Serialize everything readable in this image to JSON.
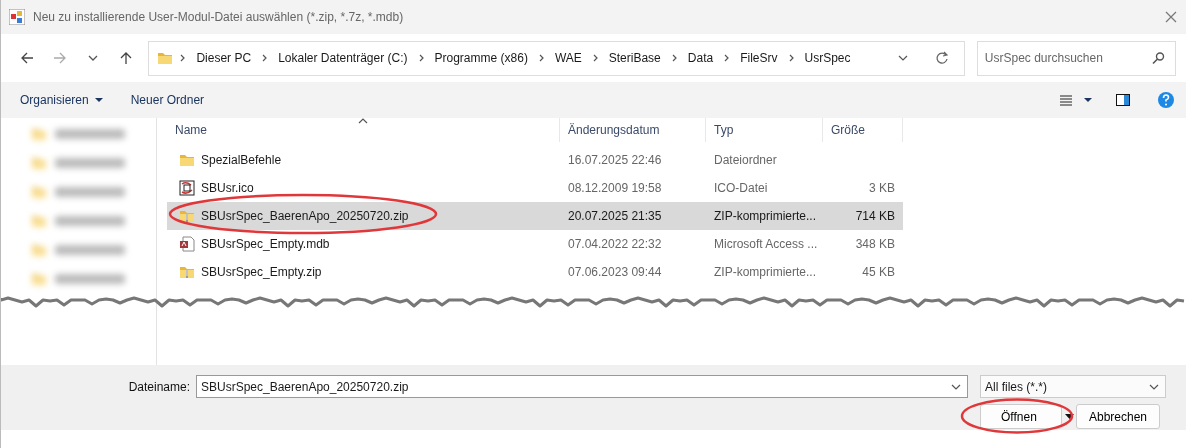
{
  "window": {
    "title": "Neu zu installierende User-Modul-Datei auswählen (*.zip, *.7z, *.mdb)"
  },
  "address_bar": {
    "breadcrumbs": [
      "Dieser PC",
      "Lokaler Datenträger (C:)",
      "Programme (x86)",
      "WAE",
      "SteriBase",
      "Data",
      "FileSrv",
      "UsrSpec"
    ]
  },
  "search": {
    "placeholder": "UsrSpec durchsuchen"
  },
  "toolbar": {
    "buttons": [
      {
        "label": "Organisieren",
        "kind": "menu"
      },
      {
        "label": "Neuer Ordner",
        "kind": "plain"
      }
    ]
  },
  "sidebar": {
    "items": [
      {
        "kind": "blurred"
      },
      {
        "kind": "blurred"
      },
      {
        "kind": "blurred"
      },
      {
        "kind": "blurred"
      },
      {
        "kind": "blurred"
      },
      {
        "kind": "blurred"
      }
    ]
  },
  "table": {
    "columns": [
      {
        "label": "Name",
        "sorted": true
      },
      {
        "label": "Änderungsdatum",
        "sorted": false
      },
      {
        "label": "Typ",
        "sorted": false
      },
      {
        "label": "Größe",
        "sorted": false
      }
    ],
    "rows": [
      {
        "kind": "folder",
        "name": "SpezialBefehle",
        "date": "16.07.2025 22:46",
        "type": "Dateiordner",
        "selected": false,
        "circled": false
      },
      {
        "kind": "ico",
        "name": "SBUsr.ico",
        "date": "08.12.2009 19:58",
        "type": "ICO-Datei",
        "size": "3 KB",
        "selected": false,
        "circled": false
      },
      {
        "kind": "zip",
        "name": "SBUsrSpec_BaerenApo_20250720.zip",
        "date": "20.07.2025 21:35",
        "type": "ZIP-komprimierte...",
        "size": "714 KB",
        "selected": true,
        "circled": true
      },
      {
        "kind": "mdb",
        "name": "SBUsrSpec_Empty.mdb",
        "date": "07.04.2022 22:32",
        "type": "Microsoft Access ...",
        "size": "348 KB",
        "selected": false,
        "circled": false
      },
      {
        "kind": "zip",
        "name": "SBUsrSpec_Empty.zip",
        "date": "07.06.2023 09:44",
        "type": "ZIP-komprimierte...",
        "size": "45 KB",
        "selected": false,
        "circled": false
      }
    ]
  },
  "footer": {
    "filename_label": "Dateiname:",
    "filename_value": "SBUsrSpec_BaerenApo_20250720.zip",
    "filter": "All files (*.*)",
    "buttons": [
      {
        "label": "Öffnen",
        "kind": "split",
        "circled": true
      },
      {
        "label": "Abbrechen",
        "kind": "plain",
        "circled": false
      }
    ]
  }
}
